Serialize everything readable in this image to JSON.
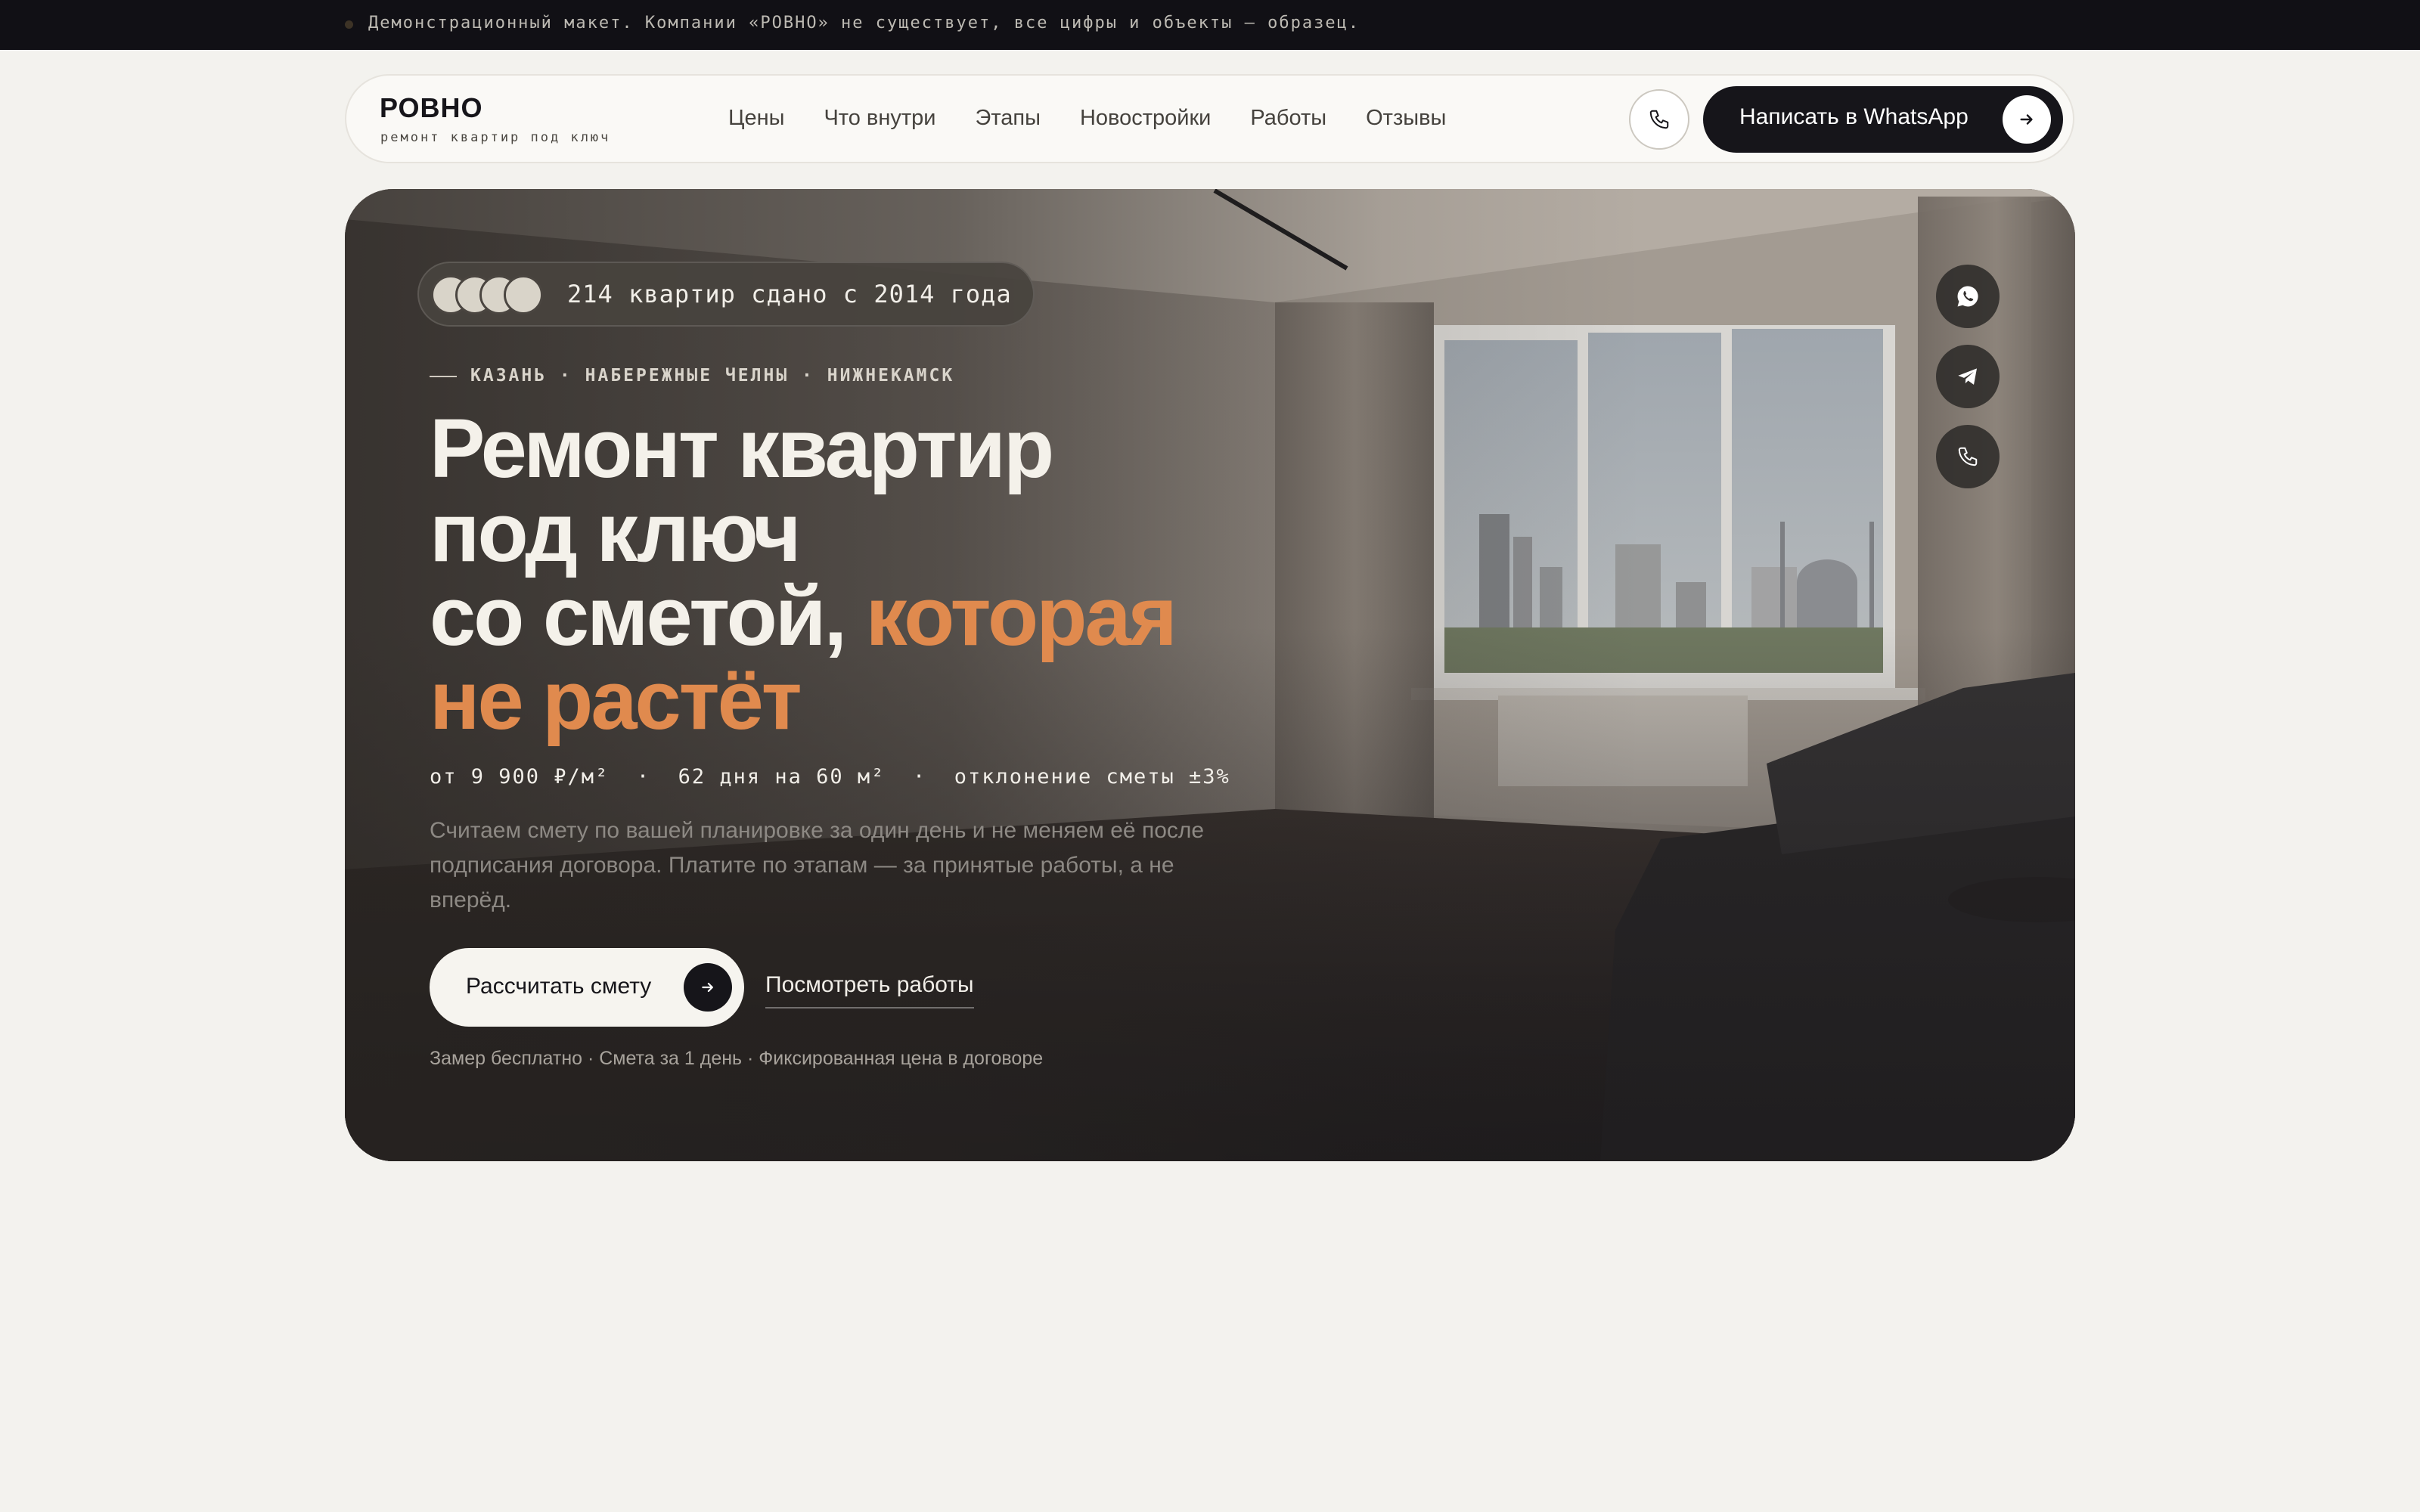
{
  "banner": {
    "text": "Демонстрационный макет. Компании «РОВНО» не существует, все цифры и объекты — образец."
  },
  "header": {
    "logo_name": "РОВНО",
    "logo_tagline": "ремонт квартир под ключ",
    "nav": [
      "Цены",
      "Что внутри",
      "Этапы",
      "Новостройки",
      "Работы",
      "Отзывы"
    ],
    "phone_icon": "phone-icon",
    "cta_label": "Написать в WhatsApp",
    "cta_icon": "arrow-right-icon"
  },
  "hero": {
    "badge_text": "214 квартир сдано с 2014 года",
    "cities": "КАЗАНЬ · НАБЕРЕЖНЫЕ ЧЕЛНЫ · НИЖНЕКАМСК",
    "title_line1": "Ремонт квартир",
    "title_line2": "под ключ",
    "title_line3_plain": "со сметой, ",
    "title_line3_accent": "которая",
    "title_line4_accent": "не растёт",
    "stats": "от 9 900 ₽/м²  ·  62 дня на 60 м²  ·  отклонение сметы ±3%",
    "description": "Считаем смету по вашей планировке за один день и не меняем её после подписания договора. Платите по этапам — за принятые работы, а не вперёд.",
    "cta_primary": "Рассчитать смету",
    "cta_secondary": "Посмотреть работы",
    "footnote": "Замер бесплатно · Смета за 1 день · Фиксированная цена в договоре",
    "side_icons": [
      "whatsapp-icon",
      "telegram-icon",
      "phone-icon"
    ]
  },
  "colors": {
    "accent": "#e08a4e",
    "dark": "#16151a",
    "page_bg": "#f3f2ee"
  }
}
